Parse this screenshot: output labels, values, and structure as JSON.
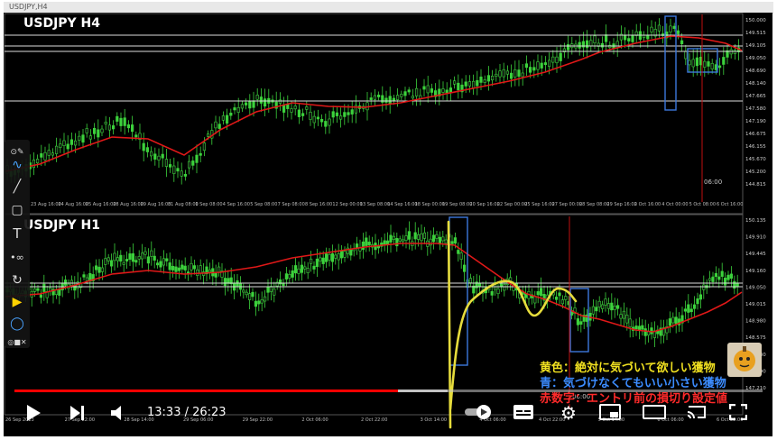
{
  "window": {
    "title": "USDJPY,H4"
  },
  "charts": {
    "top": {
      "symbol_label": "USDJPY  H4",
      "price_axis": [
        "150.000",
        "149.515",
        "149.105",
        "149.050",
        "148.690",
        "148.140",
        "147.665",
        "147.580",
        "147.190",
        "146.675",
        "146.155",
        "145.670",
        "145.200",
        "144.815"
      ],
      "time_axis": [
        "23 Aug 16:00",
        "24 Aug 16:00",
        "25 Aug 16:00",
        "28 Aug 16:00",
        "29 Aug 16:00",
        "31 Aug 08:00",
        "1 Sep 08:00",
        "4 Sep 16:00",
        "5 Sep 08:00",
        "7 Sep 08:00",
        "8 Sep 16:00",
        "12 Sep 00:00",
        "13 Sep 08:00",
        "14 Sep 16:00",
        "18 Sep 00:00",
        "19 Sep 08:00",
        "20 Sep 16:00",
        "22 Sep 00:00",
        "25 Sep 16:00",
        "27 Sep 00:00",
        "28 Sep 08:00",
        "29 Sep 16:00",
        "2 Oct 16:00",
        "4 Oct 00:00",
        "5 Oct 08:00",
        "6 Oct 16:00"
      ],
      "marker_time": "06:00"
    },
    "bottom": {
      "symbol_label": "USDJPY  H1",
      "price_axis": [
        "150.135",
        "149.910",
        "149.445",
        "149.160",
        "149.050",
        "149.015",
        "148.980",
        "148.575",
        "148.130",
        "147.690",
        "147.210"
      ],
      "time_axis": [
        "26 Sep 2023",
        "27 Sep 22:00",
        "28 Sep 14:00",
        "29 Sep 06:00",
        "29 Sep 22:00",
        "2 Oct 06:00",
        "2 Oct 22:00",
        "3 Oct 14:00",
        "4 Oct 06:00",
        "4 Oct 22:00",
        "5 Oct 14:00",
        "6 Oct 06:00",
        "6 Oct 22:00"
      ],
      "marker_time": "06:00"
    }
  },
  "overlay_notes": {
    "line1": "黄色：絶対に気づいて欲しい獲物",
    "line2": "青：気づけなくてもいい小さい獲物",
    "line3": "赤数字：エントリ前の損切り設定値"
  },
  "player": {
    "current_time": "13:33",
    "duration": "26:23",
    "time_display": "13:33 / 26:23",
    "progress_fraction": 0.513,
    "accent_color": "#ff0000"
  },
  "colors": {
    "candle_bull": "#3cd23c",
    "ma_line": "#e01818",
    "yellow_marker": "#e6dc3c",
    "blue_marker": "#3c78dc"
  }
}
